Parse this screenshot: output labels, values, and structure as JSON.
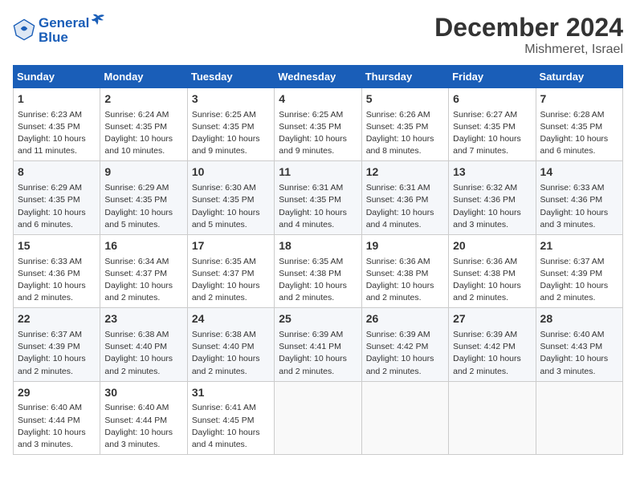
{
  "header": {
    "logo_line1": "General",
    "logo_line2": "Blue",
    "title": "December 2024",
    "subtitle": "Mishmeret, Israel"
  },
  "columns": [
    "Sunday",
    "Monday",
    "Tuesday",
    "Wednesday",
    "Thursday",
    "Friday",
    "Saturday"
  ],
  "weeks": [
    [
      {
        "day": "1",
        "info": "Sunrise: 6:23 AM\nSunset: 4:35 PM\nDaylight: 10 hours\nand 11 minutes."
      },
      {
        "day": "2",
        "info": "Sunrise: 6:24 AM\nSunset: 4:35 PM\nDaylight: 10 hours\nand 10 minutes."
      },
      {
        "day": "3",
        "info": "Sunrise: 6:25 AM\nSunset: 4:35 PM\nDaylight: 10 hours\nand 9 minutes."
      },
      {
        "day": "4",
        "info": "Sunrise: 6:25 AM\nSunset: 4:35 PM\nDaylight: 10 hours\nand 9 minutes."
      },
      {
        "day": "5",
        "info": "Sunrise: 6:26 AM\nSunset: 4:35 PM\nDaylight: 10 hours\nand 8 minutes."
      },
      {
        "day": "6",
        "info": "Sunrise: 6:27 AM\nSunset: 4:35 PM\nDaylight: 10 hours\nand 7 minutes."
      },
      {
        "day": "7",
        "info": "Sunrise: 6:28 AM\nSunset: 4:35 PM\nDaylight: 10 hours\nand 6 minutes."
      }
    ],
    [
      {
        "day": "8",
        "info": "Sunrise: 6:29 AM\nSunset: 4:35 PM\nDaylight: 10 hours\nand 6 minutes."
      },
      {
        "day": "9",
        "info": "Sunrise: 6:29 AM\nSunset: 4:35 PM\nDaylight: 10 hours\nand 5 minutes."
      },
      {
        "day": "10",
        "info": "Sunrise: 6:30 AM\nSunset: 4:35 PM\nDaylight: 10 hours\nand 5 minutes."
      },
      {
        "day": "11",
        "info": "Sunrise: 6:31 AM\nSunset: 4:35 PM\nDaylight: 10 hours\nand 4 minutes."
      },
      {
        "day": "12",
        "info": "Sunrise: 6:31 AM\nSunset: 4:36 PM\nDaylight: 10 hours\nand 4 minutes."
      },
      {
        "day": "13",
        "info": "Sunrise: 6:32 AM\nSunset: 4:36 PM\nDaylight: 10 hours\nand 3 minutes."
      },
      {
        "day": "14",
        "info": "Sunrise: 6:33 AM\nSunset: 4:36 PM\nDaylight: 10 hours\nand 3 minutes."
      }
    ],
    [
      {
        "day": "15",
        "info": "Sunrise: 6:33 AM\nSunset: 4:36 PM\nDaylight: 10 hours\nand 2 minutes."
      },
      {
        "day": "16",
        "info": "Sunrise: 6:34 AM\nSunset: 4:37 PM\nDaylight: 10 hours\nand 2 minutes."
      },
      {
        "day": "17",
        "info": "Sunrise: 6:35 AM\nSunset: 4:37 PM\nDaylight: 10 hours\nand 2 minutes."
      },
      {
        "day": "18",
        "info": "Sunrise: 6:35 AM\nSunset: 4:38 PM\nDaylight: 10 hours\nand 2 minutes."
      },
      {
        "day": "19",
        "info": "Sunrise: 6:36 AM\nSunset: 4:38 PM\nDaylight: 10 hours\nand 2 minutes."
      },
      {
        "day": "20",
        "info": "Sunrise: 6:36 AM\nSunset: 4:38 PM\nDaylight: 10 hours\nand 2 minutes."
      },
      {
        "day": "21",
        "info": "Sunrise: 6:37 AM\nSunset: 4:39 PM\nDaylight: 10 hours\nand 2 minutes."
      }
    ],
    [
      {
        "day": "22",
        "info": "Sunrise: 6:37 AM\nSunset: 4:39 PM\nDaylight: 10 hours\nand 2 minutes."
      },
      {
        "day": "23",
        "info": "Sunrise: 6:38 AM\nSunset: 4:40 PM\nDaylight: 10 hours\nand 2 minutes."
      },
      {
        "day": "24",
        "info": "Sunrise: 6:38 AM\nSunset: 4:40 PM\nDaylight: 10 hours\nand 2 minutes."
      },
      {
        "day": "25",
        "info": "Sunrise: 6:39 AM\nSunset: 4:41 PM\nDaylight: 10 hours\nand 2 minutes."
      },
      {
        "day": "26",
        "info": "Sunrise: 6:39 AM\nSunset: 4:42 PM\nDaylight: 10 hours\nand 2 minutes."
      },
      {
        "day": "27",
        "info": "Sunrise: 6:39 AM\nSunset: 4:42 PM\nDaylight: 10 hours\nand 2 minutes."
      },
      {
        "day": "28",
        "info": "Sunrise: 6:40 AM\nSunset: 4:43 PM\nDaylight: 10 hours\nand 3 minutes."
      }
    ],
    [
      {
        "day": "29",
        "info": "Sunrise: 6:40 AM\nSunset: 4:44 PM\nDaylight: 10 hours\nand 3 minutes."
      },
      {
        "day": "30",
        "info": "Sunrise: 6:40 AM\nSunset: 4:44 PM\nDaylight: 10 hours\nand 3 minutes."
      },
      {
        "day": "31",
        "info": "Sunrise: 6:41 AM\nSunset: 4:45 PM\nDaylight: 10 hours\nand 4 minutes."
      },
      {
        "day": "",
        "info": ""
      },
      {
        "day": "",
        "info": ""
      },
      {
        "day": "",
        "info": ""
      },
      {
        "day": "",
        "info": ""
      }
    ]
  ]
}
